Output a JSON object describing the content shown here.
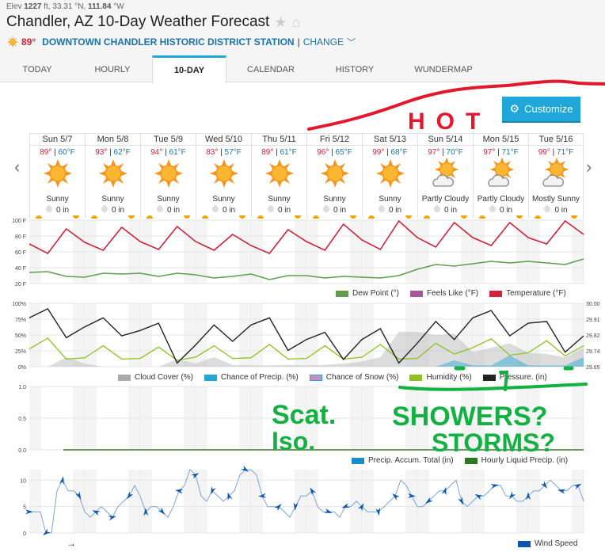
{
  "header": {
    "elev_prefix": "Elev ",
    "elev_value": "1227",
    "elev_unit": " ft, ",
    "lat": "33.31",
    "lat_unit": " °N, ",
    "lon": "111.84",
    "lon_unit": " °W",
    "title": "Chandler, AZ 10-Day Weather Forecast",
    "star_icon": "★",
    "home_icon": "⌂",
    "current_temp": "89°",
    "station_name": "DOWNTOWN CHANDLER HISTORIC DISTRICT STATION",
    "separator": "|",
    "change_label": "CHANGE",
    "change_chevron": "﹀"
  },
  "tabs": [
    {
      "label": "TODAY",
      "active": false
    },
    {
      "label": "HOURLY",
      "active": false
    },
    {
      "label": "10-DAY",
      "active": true
    },
    {
      "label": "CALENDAR",
      "active": false
    },
    {
      "label": "HISTORY",
      "active": false
    },
    {
      "label": "WUNDERMAP",
      "active": false
    }
  ],
  "customize": {
    "label": "Customize",
    "icon": "⚙"
  },
  "nav": {
    "prev": "‹",
    "next": "›"
  },
  "days": [
    {
      "name": "Sun 5/7",
      "hi": "89°",
      "lo": "60°F",
      "condition": "Sunny",
      "icon": "sunny",
      "precip": "0 in"
    },
    {
      "name": "Mon 5/8",
      "hi": "93°",
      "lo": "62°F",
      "condition": "Sunny",
      "icon": "sunny",
      "precip": "0 in"
    },
    {
      "name": "Tue 5/9",
      "hi": "94°",
      "lo": "61°F",
      "condition": "Sunny",
      "icon": "sunny",
      "precip": "0 in"
    },
    {
      "name": "Wed 5/10",
      "hi": "83°",
      "lo": "57°F",
      "condition": "Sunny",
      "icon": "sunny",
      "precip": "0 in"
    },
    {
      "name": "Thu 5/11",
      "hi": "89°",
      "lo": "61°F",
      "condition": "Sunny",
      "icon": "sunny",
      "precip": "0 in"
    },
    {
      "name": "Fri 5/12",
      "hi": "96°",
      "lo": "65°F",
      "condition": "Sunny",
      "icon": "sunny",
      "precip": "0 in"
    },
    {
      "name": "Sat 5/13",
      "hi": "99°",
      "lo": "68°F",
      "condition": "Sunny",
      "icon": "sunny",
      "precip": "0 in"
    },
    {
      "name": "Sun 5/14",
      "hi": "97°",
      "lo": "70°F",
      "condition": "Partly Cloudy",
      "icon": "partly-cloudy",
      "precip": "0 in"
    },
    {
      "name": "Mon 5/15",
      "hi": "97°",
      "lo": "71°F",
      "condition": "Partly Cloudy",
      "icon": "partly-cloudy",
      "precip": "0 in"
    },
    {
      "name": "Tue 5/16",
      "hi": "99°",
      "lo": "71°F",
      "condition": "Mostly Sunny",
      "icon": "partly-cloudy",
      "precip": "0 in"
    }
  ],
  "chart_data": [
    {
      "type": "line",
      "title": "Temperature",
      "y_ticks": [
        "100 F",
        "80 F",
        "60 F",
        "40 F",
        "20 F"
      ],
      "ylim": [
        20,
        100
      ],
      "series": [
        {
          "name": "Temperature (°F)",
          "color": "#d0243c",
          "values": [
            70,
            58,
            89,
            72,
            62,
            91,
            73,
            63,
            92,
            73,
            62,
            82,
            68,
            58,
            88,
            73,
            62,
            95,
            75,
            63,
            99,
            78,
            66,
            97,
            78,
            68,
            97,
            78,
            70,
            99,
            82
          ]
        },
        {
          "name": "Dew Point (°)",
          "color": "#5e9e4d",
          "values": [
            34,
            35,
            29,
            28,
            33,
            32,
            33,
            29,
            33,
            31,
            27,
            29,
            32,
            25,
            30,
            30,
            27,
            29,
            28,
            27,
            30,
            38,
            44,
            42,
            45,
            48,
            46,
            48,
            46,
            44,
            51
          ]
        },
        {
          "name": "Feels Like (°F)",
          "color": "#a855a0",
          "values": []
        }
      ],
      "legend": [
        "Dew Point (°)",
        "Feels Like (°F)",
        "Temperature (°F)"
      ],
      "legend_position": "bottom-right"
    },
    {
      "type": "line",
      "title": "Humidity / Pressure / Cloud",
      "y_ticks_left": [
        "100%",
        "75%",
        "50%",
        "25%",
        "0%"
      ],
      "y_ticks_right": [
        "30.00",
        "29.91",
        "29.82",
        "29.74",
        "29.65"
      ],
      "ylim_left": [
        0,
        100
      ],
      "ylim_right": [
        29.65,
        30.0
      ],
      "series": [
        {
          "name": "Pressure. (in)",
          "color": "#222222",
          "values": [
            29.92,
            29.97,
            29.81,
            29.87,
            29.92,
            29.82,
            29.85,
            29.89,
            29.67,
            29.77,
            29.88,
            29.79,
            29.88,
            29.92,
            29.74,
            29.8,
            29.84,
            29.69,
            29.8,
            29.86,
            29.67,
            29.78,
            29.9,
            29.8,
            29.92,
            29.96,
            29.82,
            29.89,
            29.9,
            29.73,
            29.82
          ]
        },
        {
          "name": "Humidity (%)",
          "color": "#8dc21f",
          "values": [
            28,
            45,
            12,
            14,
            33,
            12,
            13,
            31,
            10,
            15,
            33,
            13,
            14,
            35,
            12,
            13,
            33,
            12,
            15,
            35,
            12,
            13,
            37,
            20,
            30,
            44,
            18,
            22,
            41,
            17,
            33
          ]
        },
        {
          "name": "Cloud Cover (%)",
          "color": "#aaaaaa",
          "values": [
            0,
            0,
            15,
            5,
            0,
            0,
            0,
            0,
            12,
            5,
            15,
            3,
            2,
            2,
            3,
            2,
            3,
            5,
            8,
            15,
            55,
            55,
            50,
            52,
            23,
            30,
            37,
            22,
            20,
            15,
            30
          ]
        },
        {
          "name": "Chance of Precip. (%)",
          "color": "#1ea7d8",
          "values": [
            0,
            0,
            0,
            0,
            0,
            0,
            0,
            0,
            0,
            0,
            0,
            0,
            0,
            0,
            0,
            0,
            0,
            0,
            0,
            0,
            0,
            0,
            0,
            10,
            2,
            2,
            18,
            2,
            2,
            2,
            15
          ]
        },
        {
          "name": "Chance of Snow (%)",
          "color": "#c68fc6",
          "values": []
        }
      ],
      "legend": [
        "Cloud Cover (%)",
        "Chance of Precip. (%)",
        "Chance of Snow (%)",
        "Humidity (%)",
        "Pressure. (in)"
      ],
      "legend_position": "bottom"
    },
    {
      "type": "area",
      "title": "Precipitation",
      "y_ticks": [
        "1.0",
        "0.5",
        "0.0"
      ],
      "ylim": [
        0,
        1
      ],
      "series": [
        {
          "name": "Precip. Accum. Total (in)",
          "color": "#1a8dc6",
          "values": [
            0,
            0,
            0,
            0,
            0,
            0,
            0,
            0,
            0,
            0
          ]
        },
        {
          "name": "Hourly Liquid Precip. (in)",
          "color": "#2a7a1d",
          "values": [
            0,
            0,
            0,
            0,
            0,
            0,
            0,
            0,
            0,
            0
          ]
        }
      ],
      "legend": [
        "Precip. Accum. Total (in)",
        "Hourly Liquid Precip. (in)"
      ],
      "legend_position": "bottom-right"
    },
    {
      "type": "line",
      "title": "Wind Speed",
      "y_ticks": [
        "10",
        "5",
        "0"
      ],
      "ylim": [
        0,
        12
      ],
      "series": [
        {
          "name": "Wind Speed",
          "color": "#7aa6d6",
          "values": [
            4,
            4,
            4,
            0,
            0,
            8,
            10,
            8,
            8,
            7,
            4,
            3,
            4,
            5,
            4,
            3,
            5,
            6,
            7,
            9,
            7,
            4,
            5,
            5,
            4,
            3,
            5,
            8,
            9,
            12,
            11,
            7,
            6,
            8,
            7,
            6,
            7,
            8,
            11,
            12,
            12,
            11,
            7,
            5,
            5,
            5,
            4,
            3,
            5,
            7,
            7,
            8,
            5,
            4,
            4,
            4,
            3,
            5,
            5,
            6,
            5,
            4,
            4,
            4,
            5,
            6,
            7,
            10,
            9,
            7,
            5,
            5,
            6,
            7,
            8,
            8,
            9,
            10,
            6,
            5,
            6,
            7,
            7,
            8,
            9,
            9,
            7,
            7,
            6,
            6,
            7,
            8,
            8,
            9,
            10,
            9,
            8,
            8,
            9,
            9,
            6
          ]
        }
      ],
      "legend": [
        "Wind Speed"
      ],
      "legend_position": "bottom-right",
      "arrow_symbol": "→"
    }
  ],
  "annotations": {
    "red_text": "HOT",
    "green_text_1": "Scat.",
    "green_text_2": "Iso.",
    "green_text_3": "SHOWERS?",
    "green_text_4": "STORMS?"
  }
}
